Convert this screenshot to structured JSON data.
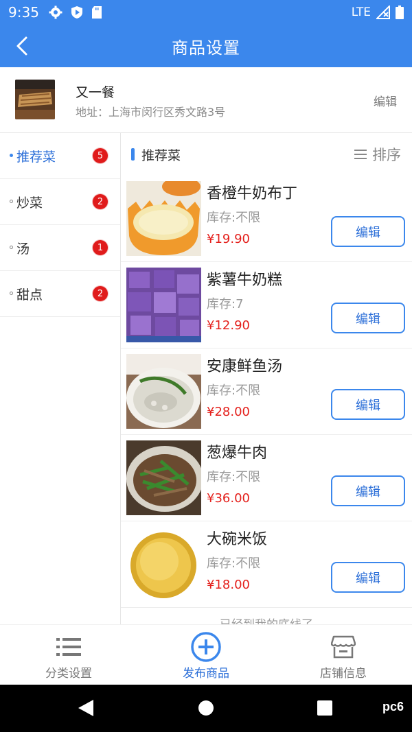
{
  "status_bar": {
    "time": "9:35",
    "network": "LTE"
  },
  "app_bar": {
    "title": "商品设置"
  },
  "store": {
    "name": "又一餐",
    "address": "地址：上海市闵行区秀文路3号",
    "edit_label": "编辑"
  },
  "categories": [
    {
      "label": "推荐菜",
      "count": "5",
      "active": true
    },
    {
      "label": "炒菜",
      "count": "2"
    },
    {
      "label": "汤",
      "count": "1"
    },
    {
      "label": "甜点",
      "count": "2"
    }
  ],
  "main": {
    "section_title": "推荐菜",
    "sort_label": "排序",
    "items": [
      {
        "name": "香橙牛奶布丁",
        "stock": "库存:不限",
        "price": "¥19.90",
        "edit": "编辑"
      },
      {
        "name": "紫薯牛奶糕",
        "stock": "库存:7",
        "price": "¥12.90",
        "edit": "编辑"
      },
      {
        "name": "安康鲜鱼汤",
        "stock": "库存:不限",
        "price": "¥28.00",
        "edit": "编辑"
      },
      {
        "name": "葱爆牛肉",
        "stock": "库存:不限",
        "price": "¥36.00",
        "edit": "编辑"
      },
      {
        "name": "大碗米饭",
        "stock": "库存:不限",
        "price": "¥18.00",
        "edit": "编辑"
      }
    ],
    "end_text": "已经到我的底线了"
  },
  "tabs": [
    {
      "label": "分类设置",
      "icon": "list-icon"
    },
    {
      "label": "发布商品",
      "icon": "plus-circle-icon",
      "active": true
    },
    {
      "label": "店铺信息",
      "icon": "store-icon"
    }
  ],
  "watermark": "pc6",
  "colors": {
    "accent": "#3b87ec",
    "price": "#e4201c",
    "badge": "#e01b1b"
  }
}
